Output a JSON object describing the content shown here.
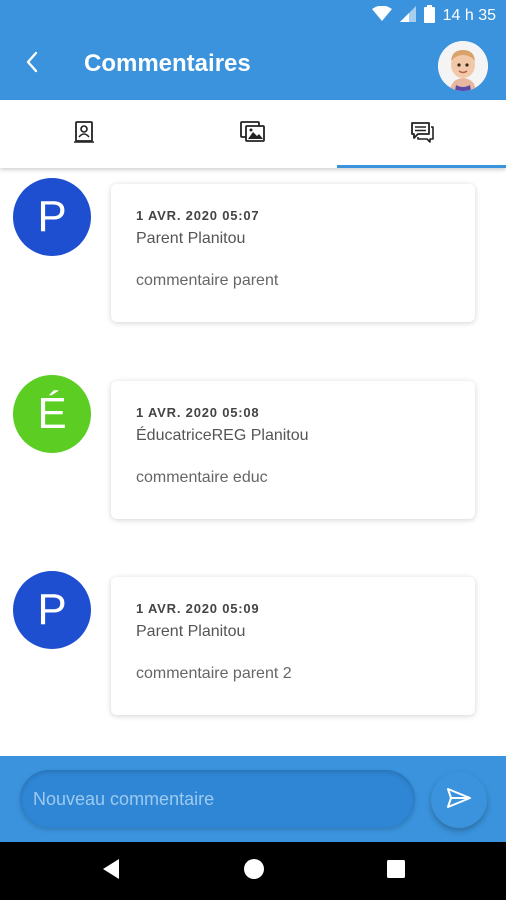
{
  "status_bar": {
    "time": "14 h 35"
  },
  "app_bar": {
    "title": "Commentaires"
  },
  "tabs": [
    {
      "icon": "contact-card-icon",
      "active": false
    },
    {
      "icon": "photo-gallery-icon",
      "active": false
    },
    {
      "icon": "comments-icon",
      "active": true
    }
  ],
  "comments": [
    {
      "initial": "P",
      "avatar_color": "#1e4fd1",
      "date": "1 AVR. 2020 05:07",
      "author": "Parent Planitou",
      "text": "commentaire parent"
    },
    {
      "initial": "É",
      "avatar_color": "#5ccd23",
      "date": "1 AVR. 2020 05:08",
      "author": "ÉducatriceREG Planitou",
      "text": "commentaire educ"
    },
    {
      "initial": "P",
      "avatar_color": "#1e4fd1",
      "date": "1 AVR. 2020 05:09",
      "author": "Parent Planitou",
      "text": "commentaire parent 2"
    }
  ],
  "input": {
    "placeholder": "Nouveau commentaire",
    "value": ""
  },
  "colors": {
    "primary": "#3a93dc",
    "avatar_blue": "#1e4fd1",
    "avatar_green": "#5ccd23"
  }
}
